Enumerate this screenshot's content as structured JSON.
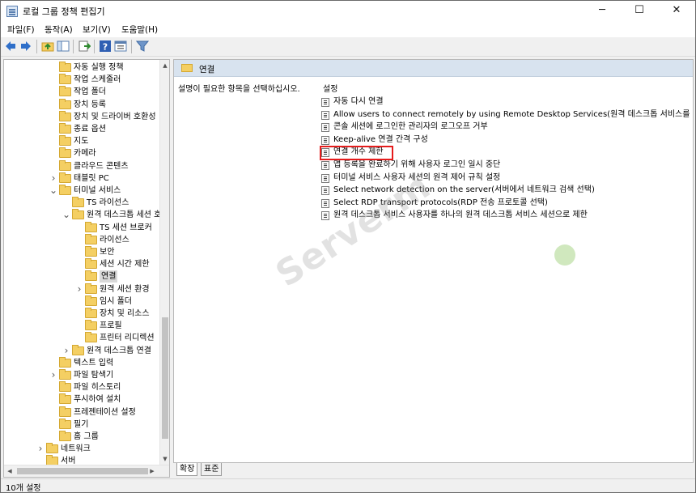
{
  "window": {
    "title": "로컬 그룹 정책 편집기",
    "minimize": "─",
    "maximize": "☐",
    "close": "✕"
  },
  "menu": [
    "파일(F)",
    "동작(A)",
    "보기(V)",
    "도움말(H)"
  ],
  "toolbar": {
    "icons": [
      "back-icon",
      "forward-icon",
      "up-folder-icon",
      "show-tree-icon",
      "export-list-icon",
      "help-icon",
      "properties-icon",
      "filter-icon"
    ]
  },
  "tree": {
    "items": [
      {
        "label": "자동 실행 정책",
        "indent": 1,
        "expander": ""
      },
      {
        "label": "작업 스케줄러",
        "indent": 1,
        "expander": ""
      },
      {
        "label": "작업 폴더",
        "indent": 1,
        "expander": ""
      },
      {
        "label": "장치 등록",
        "indent": 1,
        "expander": ""
      },
      {
        "label": "장치 및 드라이버 호환성",
        "indent": 1,
        "expander": ""
      },
      {
        "label": "종료 옵션",
        "indent": 1,
        "expander": ""
      },
      {
        "label": "지도",
        "indent": 1,
        "expander": ""
      },
      {
        "label": "카메라",
        "indent": 1,
        "expander": ""
      },
      {
        "label": "클라우드 콘텐츠",
        "indent": 1,
        "expander": ""
      },
      {
        "label": "태블릿 PC",
        "indent": 1,
        "expander": ">"
      },
      {
        "label": "터미널 서비스",
        "indent": 1,
        "expander": "v"
      },
      {
        "label": "TS 라이선스",
        "indent": 2,
        "expander": ""
      },
      {
        "label": "원격 데스크톱 세션 호스트",
        "indent": 2,
        "expander": "v"
      },
      {
        "label": "TS 세션 브로커",
        "indent": 3,
        "expander": ""
      },
      {
        "label": "라이선스",
        "indent": 3,
        "expander": ""
      },
      {
        "label": "보안",
        "indent": 3,
        "expander": ""
      },
      {
        "label": "세션 시간 제한",
        "indent": 3,
        "expander": ""
      },
      {
        "label": "연결",
        "indent": 3,
        "expander": "",
        "selected": true
      },
      {
        "label": "원격 세션 환경",
        "indent": 3,
        "expander": ">"
      },
      {
        "label": "임시 폴더",
        "indent": 3,
        "expander": ""
      },
      {
        "label": "장치 및 리소스",
        "indent": 3,
        "expander": ""
      },
      {
        "label": "프로필",
        "indent": 3,
        "expander": ""
      },
      {
        "label": "프린터 리디렉션",
        "indent": 3,
        "expander": ""
      },
      {
        "label": "원격 데스크톱 연결",
        "indent": 2,
        "expander": ">"
      },
      {
        "label": "텍스트 입력",
        "indent": 1,
        "expander": ""
      },
      {
        "label": "파일 탐색기",
        "indent": 1,
        "expander": ">"
      },
      {
        "label": "파일 히스토리",
        "indent": 1,
        "expander": ""
      },
      {
        "label": "푸시하여 설치",
        "indent": 1,
        "expander": ""
      },
      {
        "label": "프레젠테이션 설정",
        "indent": 1,
        "expander": ""
      },
      {
        "label": "필기",
        "indent": 1,
        "expander": ""
      },
      {
        "label": "홈 그룹",
        "indent": 1,
        "expander": ""
      },
      {
        "label": "네트워크",
        "indent": 0,
        "expander": ">"
      },
      {
        "label": "서버",
        "indent": 0,
        "expander": ""
      }
    ]
  },
  "content": {
    "header": "연결",
    "description": "설명이 필요한 항목을 선택하십시오.",
    "column_header": "설정",
    "settings": [
      "자동 다시 연결",
      "Allow users to connect remotely by using Remote Desktop Services(원격 데스크톱 서비스를 사용하여",
      "콘솔 세션에 로그인한 관리자의 로그오프 거부",
      "Keep-alive 연결 간격 구성",
      "연결 개수 제한",
      "앱 등록을 완료하기 위해 사용자 로그인 일시 중단",
      "터미널 서비스 사용자 세션의 원격 제어 규칙 설정",
      "Select network detection on the server(서버에서 네트워크 검색 선택)",
      "Select RDP transport protocols(RDP 전송 프로토콜 선택)",
      "원격 데스크톱 서비스 사용자를 하나의 원격 데스크톱 서비스 세션으로 제한"
    ],
    "highlighted_index": 4
  },
  "watermark": "Serverm",
  "tabs": [
    "확장",
    "표준"
  ],
  "status": "10개 설정"
}
